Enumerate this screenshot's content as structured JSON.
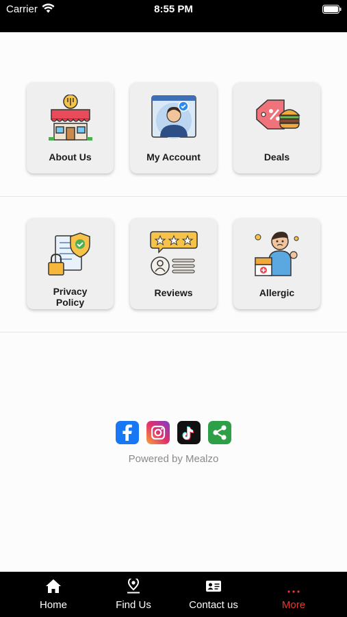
{
  "status_bar": {
    "carrier": "Carrier",
    "time": "8:55 PM"
  },
  "menu": {
    "row1": [
      {
        "label": "About Us",
        "icon": "restaurant-icon"
      },
      {
        "label": "My Account",
        "icon": "account-icon"
      },
      {
        "label": "Deals",
        "icon": "deals-icon"
      }
    ],
    "row2": [
      {
        "label_line1": "Privacy",
        "label_line2": "Policy",
        "icon": "privacy-policy-icon"
      },
      {
        "label": "Reviews",
        "icon": "reviews-icon"
      },
      {
        "label": "Allergic",
        "icon": "allergic-icon"
      }
    ]
  },
  "social": [
    "facebook-icon",
    "instagram-icon",
    "tiktok-icon",
    "share-icon"
  ],
  "footer": {
    "powered_by": "Powered by Mealzo"
  },
  "tab_bar": {
    "tabs": [
      {
        "label": "Home",
        "icon": "home-icon"
      },
      {
        "label": "Find Us",
        "icon": "location-pin-icon"
      },
      {
        "label": "Contact us",
        "icon": "contact-card-icon"
      },
      {
        "label": "More",
        "icon": "more-dots-icon",
        "active": true
      }
    ],
    "active_color": "#e53935"
  }
}
